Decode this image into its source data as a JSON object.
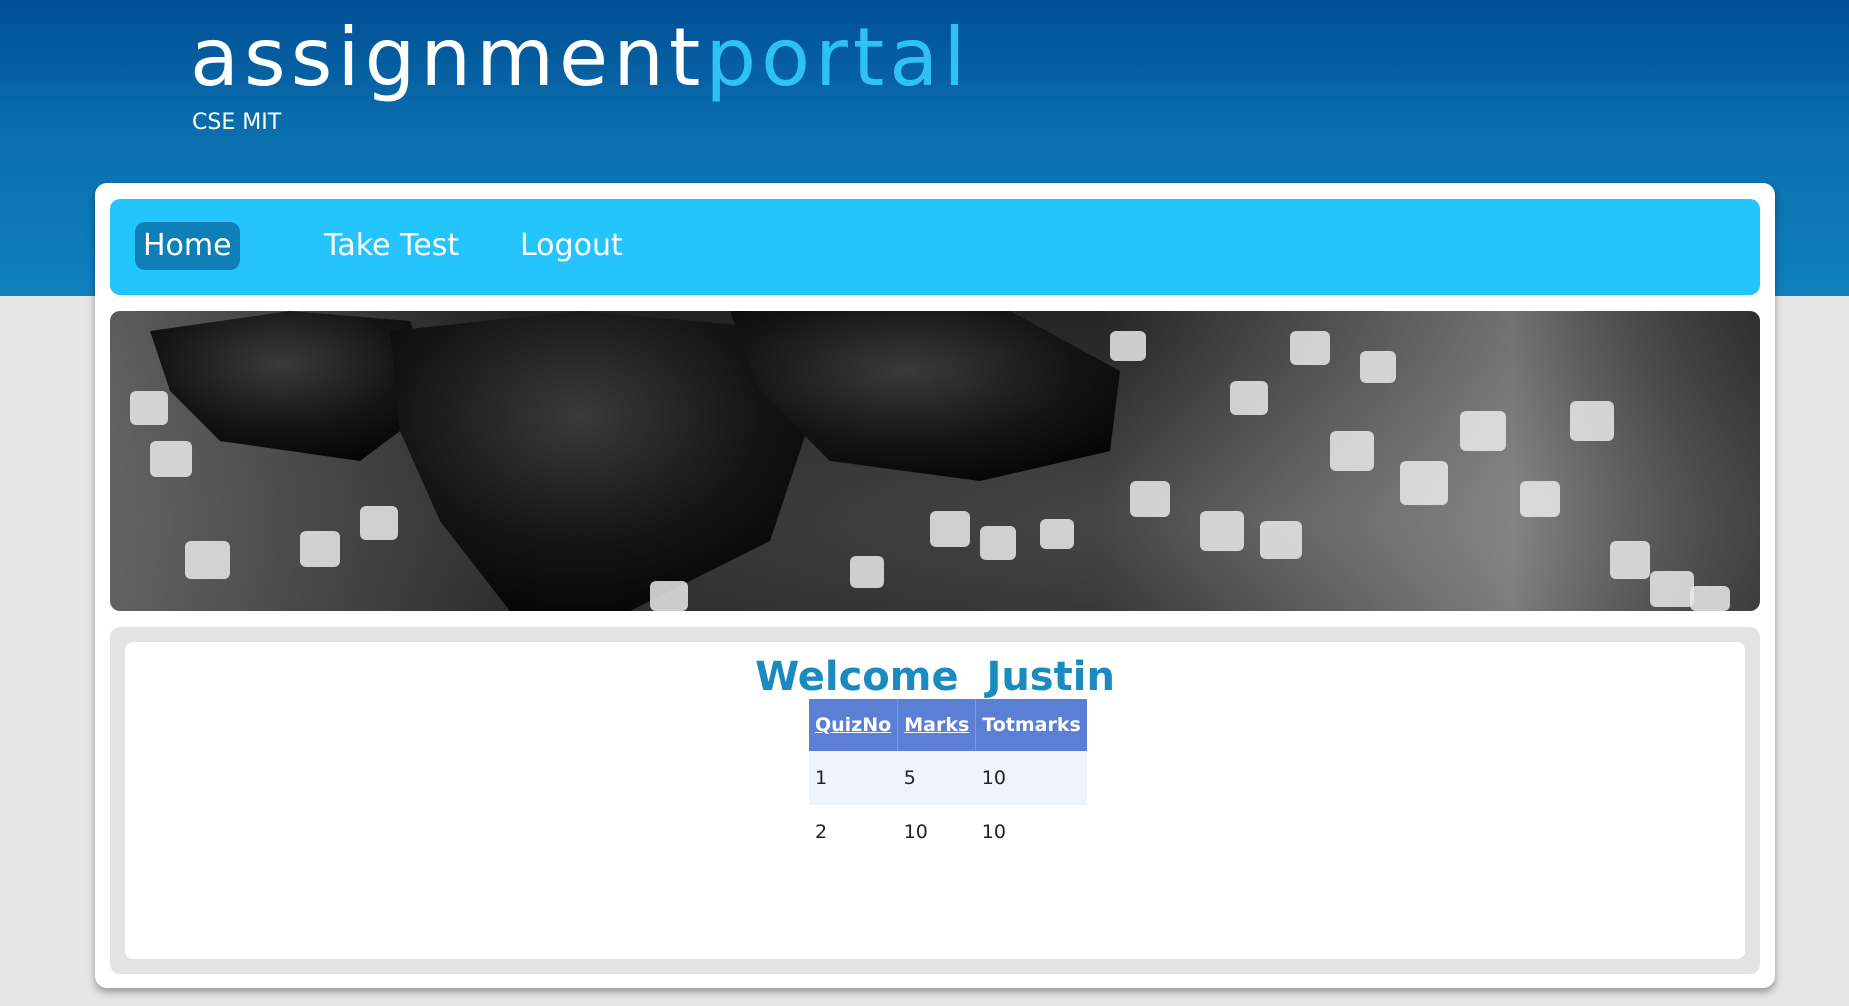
{
  "header": {
    "logo_part1": "assignment",
    "logo_part2": "portal",
    "subtitle": "CSE MIT"
  },
  "nav": {
    "items": [
      {
        "label": "Home",
        "active": true
      },
      {
        "label": "Take Test",
        "active": false
      },
      {
        "label": "Logout",
        "active": false
      }
    ]
  },
  "content": {
    "welcome": "Welcome  Justin",
    "table": {
      "headers": [
        {
          "label": "QuizNo",
          "sortable": true
        },
        {
          "label": "Marks",
          "sortable": true
        },
        {
          "label": "Totmarks",
          "sortable": false
        }
      ],
      "rows": [
        [
          "1",
          "5",
          "10"
        ],
        [
          "2",
          "10",
          "10"
        ]
      ]
    }
  },
  "colors": {
    "header_dark": "#004f95",
    "header_light": "#0f80be",
    "logo_accent": "#2ec2f4",
    "nav_background": "#24c4fd",
    "nav_active": "#0f7fb8",
    "welcome_text": "#1a8bbf",
    "table_header": "#5a7fd4",
    "table_row_alt": "#eef3fc",
    "page_background": "#e6e6e6"
  }
}
